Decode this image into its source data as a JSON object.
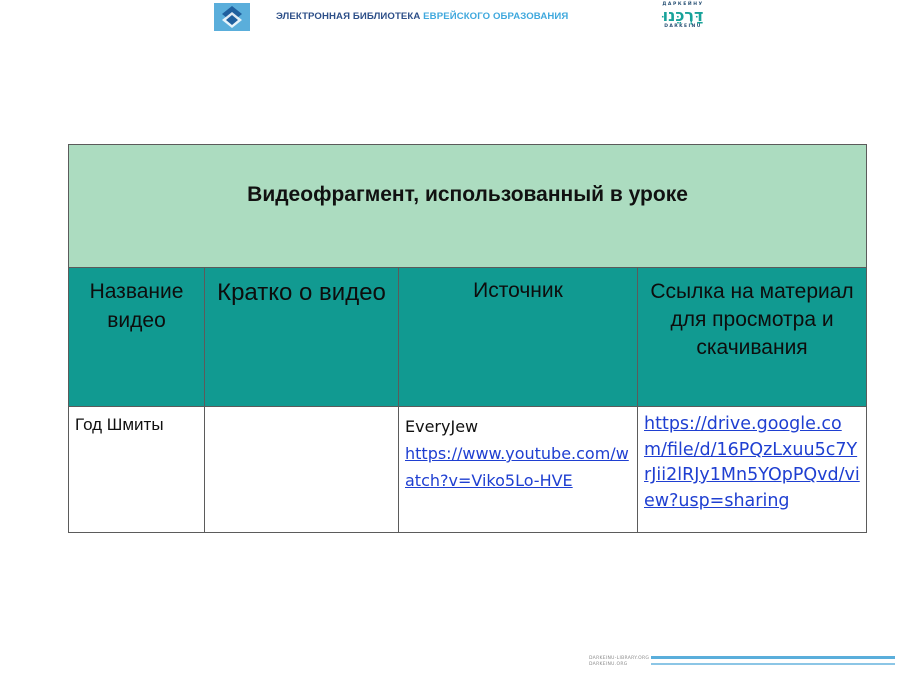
{
  "header": {
    "brand_part1": "ЭЛЕКТРОННАЯ БИБЛИОТЕКА",
    "brand_part2": "ЕВРЕЙСКОГО ОБРАЗОВАНИЯ",
    "logo_top": "ДАРКЕЙНУ",
    "logo_mark": "דַּרְכֵּנוּ",
    "logo_bottom": "DARKEINU"
  },
  "table": {
    "title": "Видеофрагмент, использованный в уроке",
    "columns": [
      "Название видео",
      "Кратко о видео",
      "Источник",
      "Ссылка на материал для просмотра и скачивания"
    ],
    "rows": [
      {
        "name": "Год Шмиты",
        "summary": "",
        "source_name": "EveryJew",
        "source_link": "https://www.youtube.com/watch?v=Viko5Lo-HVE",
        "material_link": "https://drive.google.com/file/d/16PQzLxuu5c7YrJii2lRJy1Mn5YOpPQvd/view?usp=sharing"
      }
    ]
  },
  "footer": {
    "line1": "DARKEINU-LIBRARY.ORG",
    "line2": "DARKEINU.ORG"
  },
  "colors": {
    "title_bg": "#acdcc0",
    "header_bg": "#119a91",
    "link": "#1f3fd1",
    "brand_dark": "#2d4f88",
    "brand_light": "#3fa8dd"
  }
}
